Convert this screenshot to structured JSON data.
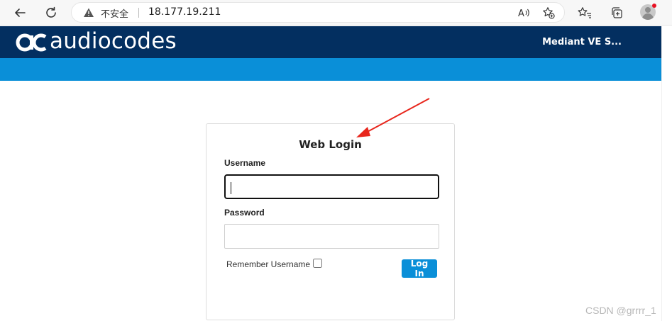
{
  "browser": {
    "security_label": "不安全",
    "url": "18.177.19.211",
    "icons": [
      "back-icon",
      "refresh-icon",
      "warning-icon",
      "read-aloud-icon",
      "add-favorite-icon",
      "favorites-icon",
      "collections-icon",
      "profile-icon"
    ]
  },
  "header": {
    "logo_text": "audiocodes",
    "product_name": "Mediant VE S..."
  },
  "login": {
    "title": "Web Login",
    "username_label": "Username",
    "username_value": "",
    "password_label": "Password",
    "password_value": "",
    "remember_label": "Remember Username",
    "remember_checked": false,
    "submit_label": "Log In"
  },
  "colors": {
    "header_bg": "#032f60",
    "accent_blue": "#0a8fd8",
    "annotation_arrow": "#e8261c"
  },
  "watermark": "CSDN @grrrr_1"
}
